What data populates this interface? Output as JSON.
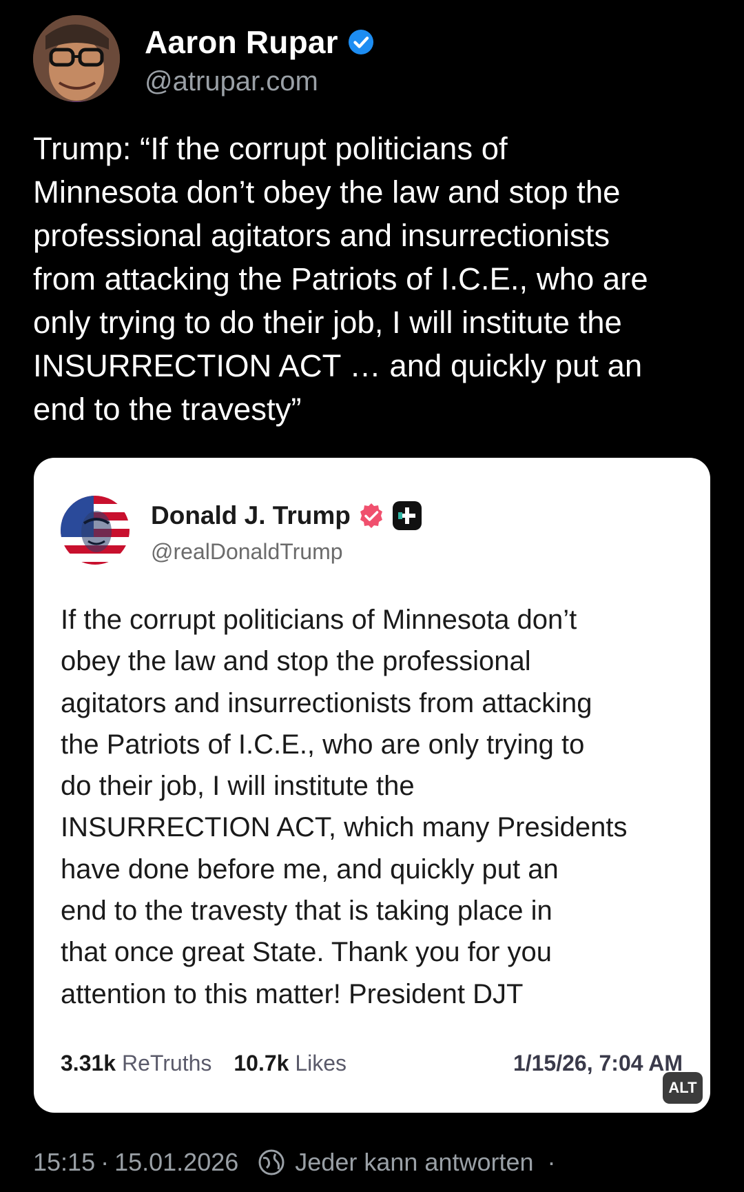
{
  "post": {
    "author_name": "Aaron Rupar",
    "handle": "@atrupar.com",
    "text": "Trump: “If the corrupt politicians of\nMinnesota don’t obey the law and stop the\nprofessional agitators and insurrectionists\nfrom attacking the Patriots of I.C.E., who are\nonly trying to do their job, I will institute the\nINSURRECTION ACT … and quickly put an\nend to the travesty”"
  },
  "quoted_image": {
    "author_name": "Donald J. Trump",
    "handle": "@realDonaldTrump",
    "text": "If the corrupt politicians of Minnesota don’t\nobey the law and stop the professional\nagitators and insurrectionists from attacking\nthe Patriots of I.C.E., who are only trying to\ndo their job, I will institute the\nINSURRECTION ACT, which many Presidents\nhave done before me, and quickly put an\nend to the travesty that is taking place in\nthat once great State. Thank you for you\nattention to this matter! President DJT",
    "retruths_count": "3.31k",
    "retruths_label": "ReTruths",
    "likes_count": "10.7k",
    "likes_label": "Likes",
    "date": "1/15/26, 7:04 AM",
    "alt_badge": "ALT"
  },
  "footer": {
    "time": "15:15",
    "separator": "·",
    "date": "15.01.2026",
    "reply_setting": "Jeder kann antworten",
    "trailing_dot": "·"
  },
  "icons": {
    "verified": "verified-badge-icon",
    "truth_verified": "verified-badge-icon",
    "truth_plus": "truth-plus-icon",
    "reply_scope": "globe-icon"
  },
  "colors": {
    "background": "#000000",
    "verified_blue": "#1d8df2",
    "truth_verified": "#f0506e",
    "muted": "#9aa0a6"
  }
}
